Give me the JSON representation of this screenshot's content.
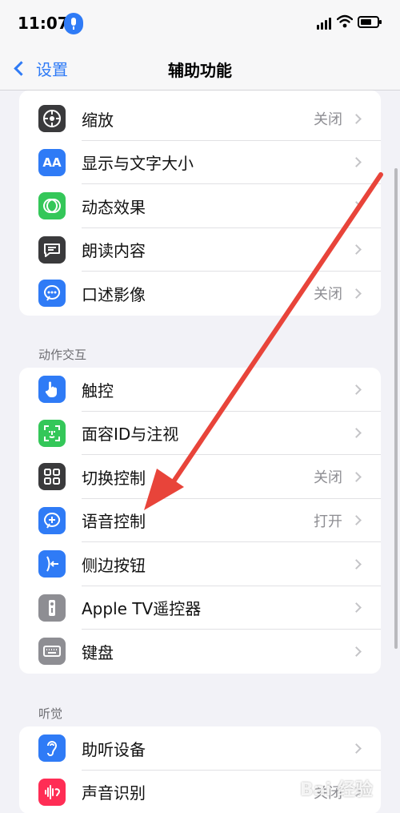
{
  "status_bar": {
    "time": "11:07"
  },
  "nav": {
    "back_label": "设置",
    "title": "辅助功能"
  },
  "groups": [
    {
      "header": "",
      "items": [
        {
          "label": "缩放",
          "value": "关闭",
          "icon": "zoom-icon",
          "color": "#3a3a3c"
        },
        {
          "label": "显示与文字大小",
          "value": "",
          "icon": "text-size-icon",
          "color": "#2f7bf6"
        },
        {
          "label": "动态效果",
          "value": "",
          "icon": "motion-icon",
          "color": "#34c759"
        },
        {
          "label": "朗读内容",
          "value": "",
          "icon": "speech-bubble-icon",
          "color": "#3a3a3c"
        },
        {
          "label": "口述影像",
          "value": "关闭",
          "icon": "audio-description-icon",
          "color": "#2f7bf6"
        }
      ]
    },
    {
      "header": "动作交互",
      "items": [
        {
          "label": "触控",
          "value": "",
          "icon": "hand-icon",
          "color": "#2f7bf6"
        },
        {
          "label": "面容ID与注视",
          "value": "",
          "icon": "face-id-icon",
          "color": "#34c759"
        },
        {
          "label": "切换控制",
          "value": "关闭",
          "icon": "switch-control-icon",
          "color": "#3a3a3c"
        },
        {
          "label": "语音控制",
          "value": "打开",
          "icon": "voice-control-icon",
          "color": "#2f7bf6"
        },
        {
          "label": "侧边按钮",
          "value": "",
          "icon": "side-button-icon",
          "color": "#2f7bf6"
        },
        {
          "label": "Apple TV遥控器",
          "value": "",
          "icon": "remote-icon",
          "color": "#8e8e93"
        },
        {
          "label": "键盘",
          "value": "",
          "icon": "keyboard-icon",
          "color": "#8e8e93"
        }
      ]
    },
    {
      "header": "听觉",
      "items": [
        {
          "label": "助听设备",
          "value": "",
          "icon": "ear-icon",
          "color": "#2f7bf6"
        },
        {
          "label": "声音识别",
          "value": "关闭",
          "icon": "sound-recognition-icon",
          "color": "#ff2d55"
        }
      ]
    }
  ],
  "annotation": {
    "arrow_color": "#e8443a"
  },
  "watermark": "Bai 经验"
}
